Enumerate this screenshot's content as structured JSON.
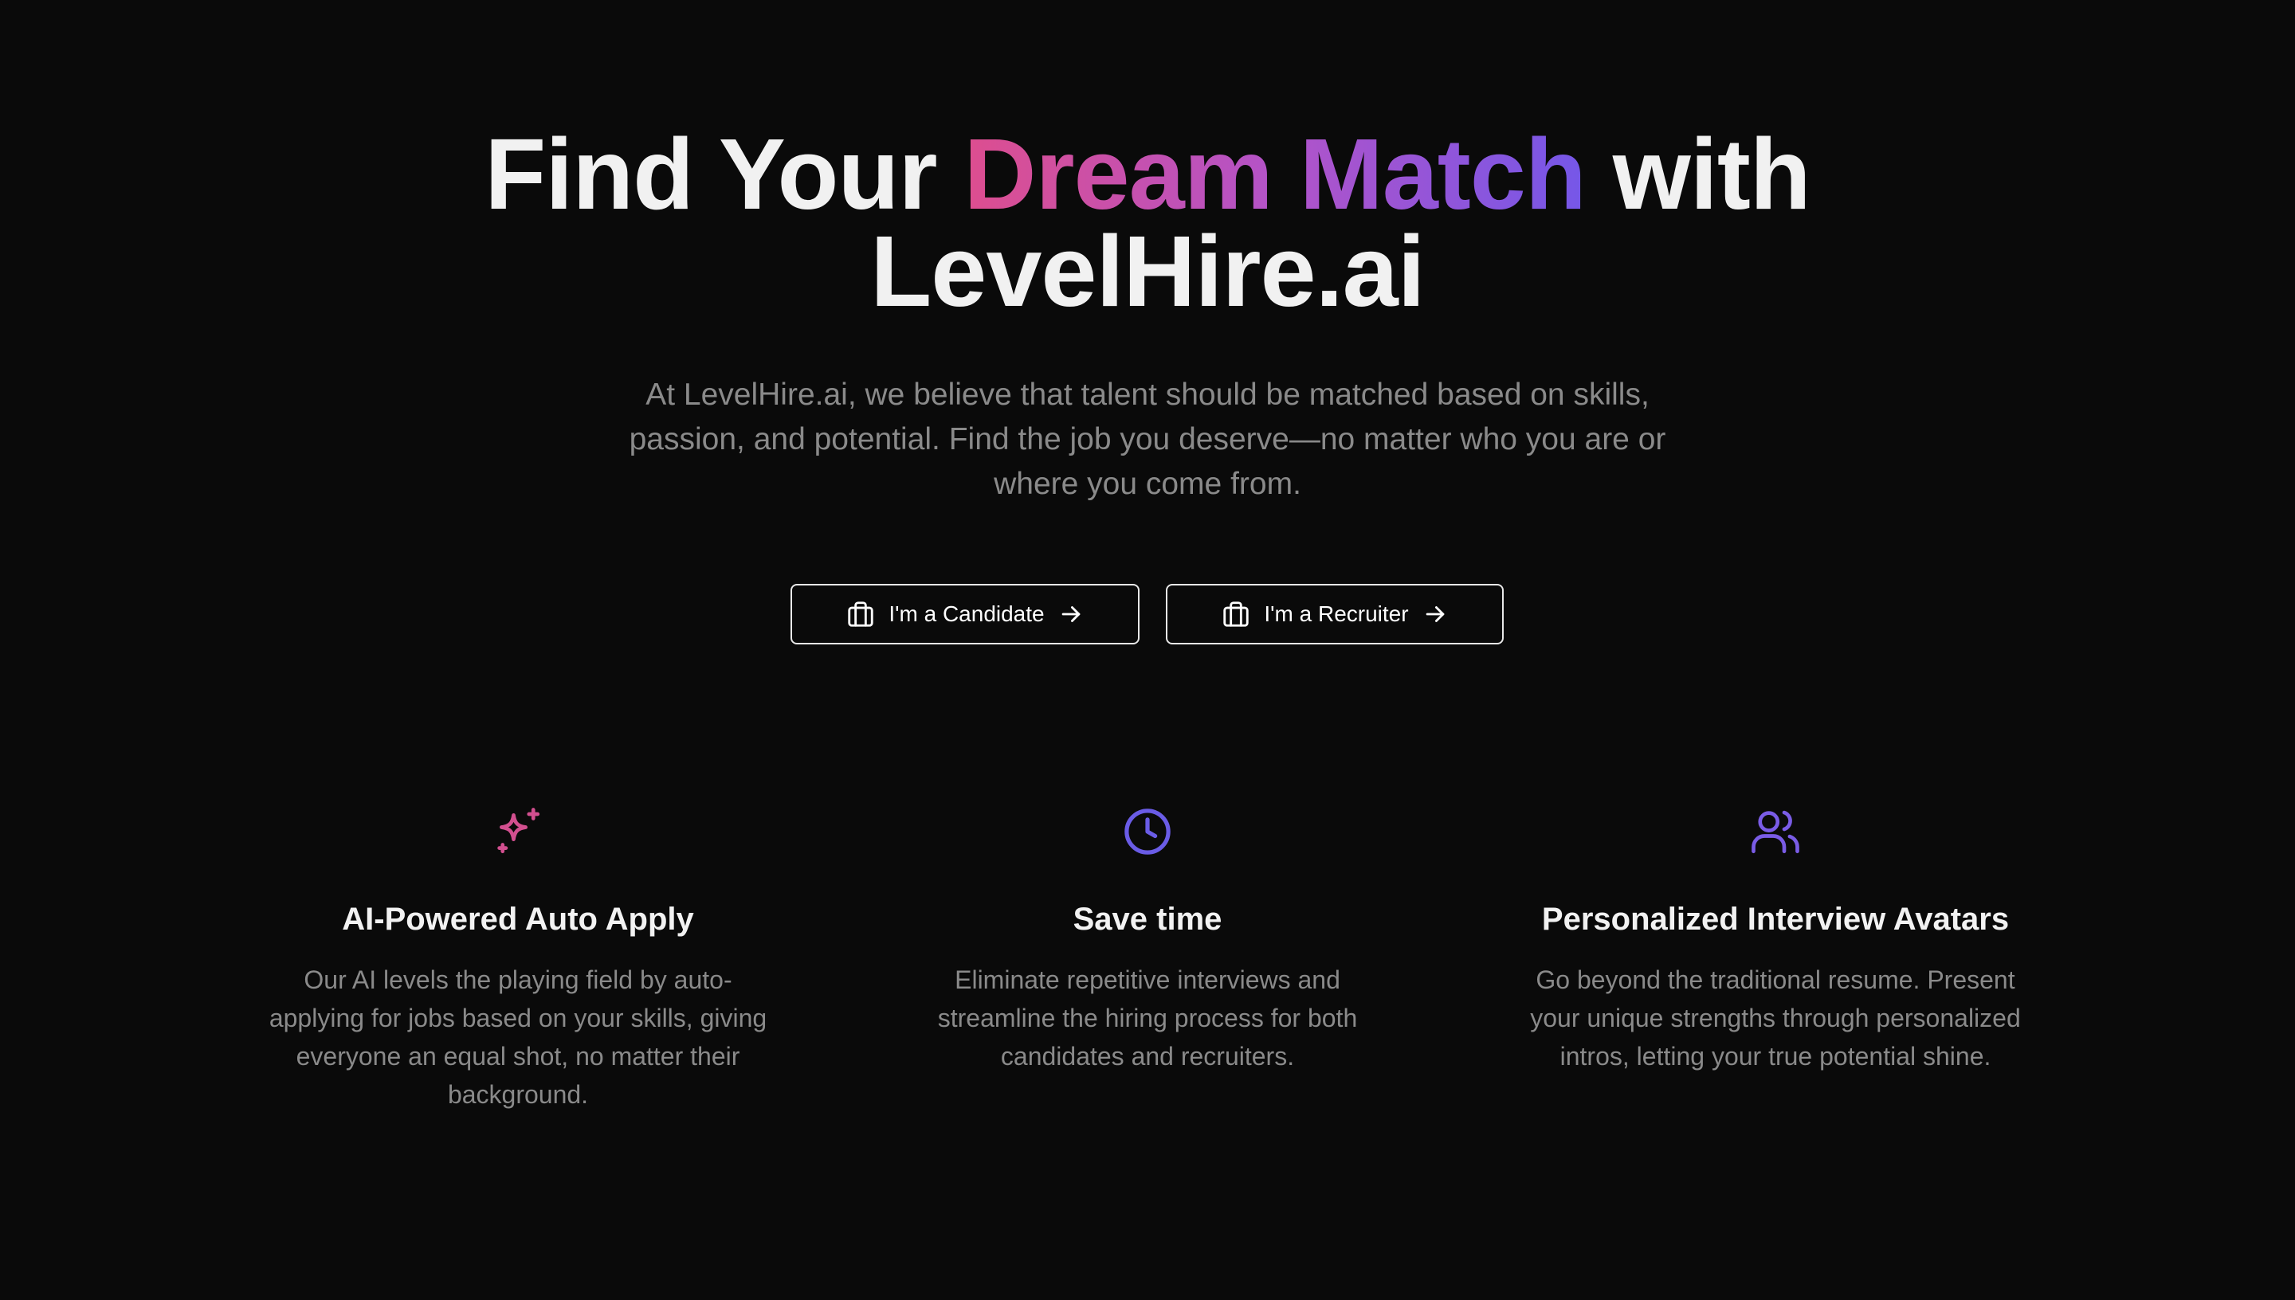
{
  "hero": {
    "title_prefix": "Find Your ",
    "title_accent": "Dream Match",
    "title_suffix": " with",
    "title_line2": "LevelHire.ai",
    "subtitle": "At LevelHire.ai, we believe that talent should be matched based on skills, passion, and potential. Find the job you deserve—no matter who you are or where you come from.",
    "accent_gradient": [
      "#dd4e8f",
      "#b353c8",
      "#7557e8"
    ]
  },
  "cta": {
    "candidate_label": "I'm a Candidate",
    "recruiter_label": "I'm a Recruiter",
    "icon": "briefcase-icon",
    "arrow_icon": "arrow-right-icon"
  },
  "features": [
    {
      "icon": "sparkles-icon",
      "icon_color": "#d24f8f",
      "title": "AI-Powered Auto Apply",
      "description": "Our AI levels the playing field by auto-applying for jobs based on your skills, giving everyone an equal shot, no matter their background."
    },
    {
      "icon": "clock-icon",
      "icon_color": "#6a5ce6",
      "title": "Save time",
      "description": "Eliminate repetitive interviews and streamline the hiring process for both candidates and recruiters."
    },
    {
      "icon": "users-icon",
      "icon_color": "#7a5ce6",
      "title": "Personalized Interview Avatars",
      "description": "Go beyond the traditional resume. Present your unique strengths through personalized intros, letting your true potential shine."
    }
  ],
  "colors": {
    "background": "#0a0a0a",
    "text": "#f2f2f2",
    "muted": "#8a8a8a"
  }
}
